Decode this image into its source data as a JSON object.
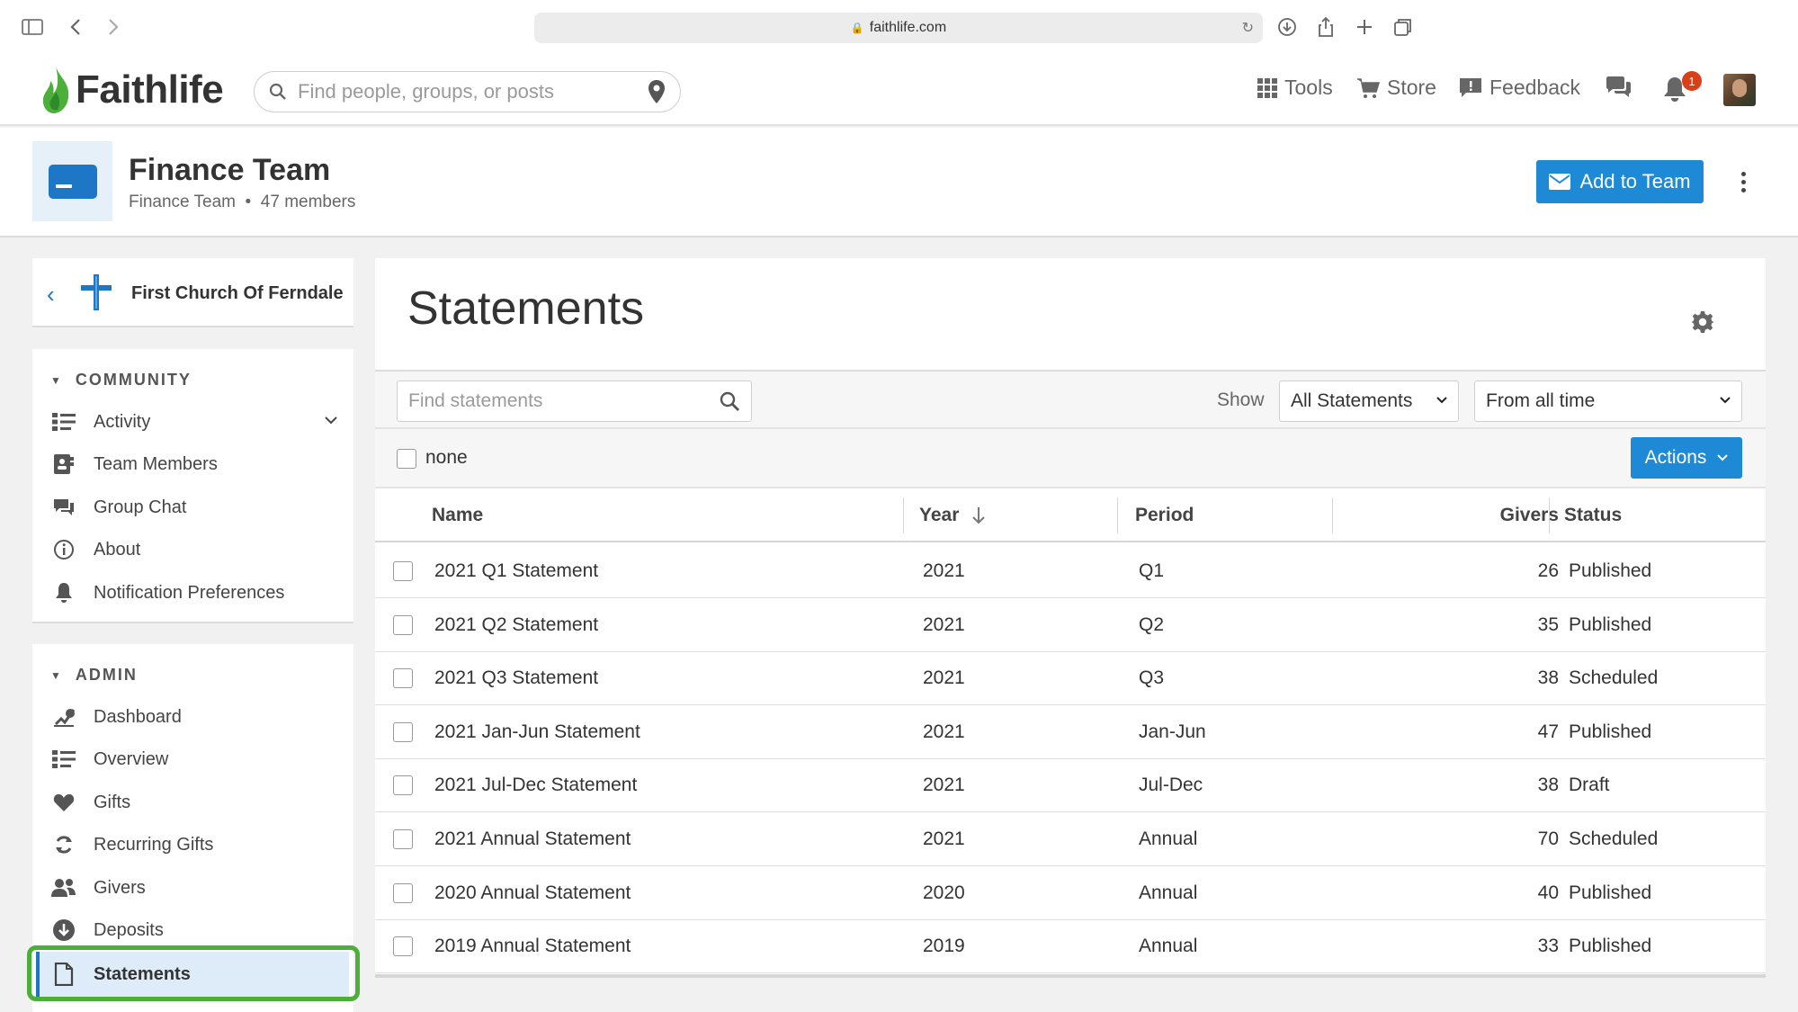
{
  "browser": {
    "url": "faithlife.com"
  },
  "header": {
    "brand": "Faithlife",
    "search_placeholder": "Find people, groups, or posts",
    "nav": {
      "tools": "Tools",
      "store": "Store",
      "feedback": "Feedback"
    },
    "notification_count": "1"
  },
  "group": {
    "title": "Finance Team",
    "subtitle_type": "Finance Team",
    "subtitle_members": "47 members",
    "add_button": "Add to Team"
  },
  "sidebar": {
    "church": "First Church Of Ferndale",
    "community_heading": "COMMUNITY",
    "community_items": [
      {
        "label": "Activity",
        "icon": "activity-list-icon"
      },
      {
        "label": "Team Members",
        "icon": "team-members-icon"
      },
      {
        "label": "Group Chat",
        "icon": "chat-bubble-icon"
      },
      {
        "label": "About",
        "icon": "info-icon"
      },
      {
        "label": "Notification Preferences",
        "icon": "bell-icon"
      }
    ],
    "admin_heading": "ADMIN",
    "admin_items": [
      {
        "label": "Dashboard",
        "icon": "dashboard-icon"
      },
      {
        "label": "Overview",
        "icon": "overview-list-icon"
      },
      {
        "label": "Gifts",
        "icon": "heart-icon"
      },
      {
        "label": "Recurring Gifts",
        "icon": "recurring-icon"
      },
      {
        "label": "Givers",
        "icon": "givers-icon"
      },
      {
        "label": "Deposits",
        "icon": "deposit-icon"
      },
      {
        "label": "Statements",
        "icon": "document-icon",
        "active": true
      }
    ]
  },
  "main": {
    "title": "Statements",
    "find_placeholder": "Find statements",
    "show_label": "Show",
    "show_select": "All Statements",
    "time_select": "From all time",
    "select_none": "none",
    "actions_label": "Actions",
    "columns": {
      "name": "Name",
      "year": "Year",
      "period": "Period",
      "givers": "Givers",
      "status": "Status"
    },
    "rows": [
      {
        "name": "2021 Q1 Statement",
        "year": "2021",
        "period": "Q1",
        "givers": "26",
        "status": "Published"
      },
      {
        "name": "2021 Q2 Statement",
        "year": "2021",
        "period": "Q2",
        "givers": "35",
        "status": "Published"
      },
      {
        "name": "2021 Q3 Statement",
        "year": "2021",
        "period": "Q3",
        "givers": "38",
        "status": "Scheduled"
      },
      {
        "name": "2021 Jan-Jun Statement",
        "year": "2021",
        "period": "Jan-Jun",
        "givers": "47",
        "status": "Published"
      },
      {
        "name": "2021 Jul-Dec Statement",
        "year": "2021",
        "period": "Jul-Dec",
        "givers": "38",
        "status": "Draft"
      },
      {
        "name": "2021 Annual Statement",
        "year": "2021",
        "period": "Annual",
        "givers": "70",
        "status": "Scheduled"
      },
      {
        "name": "2020 Annual Statement",
        "year": "2020",
        "period": "Annual",
        "givers": "40",
        "status": "Published"
      },
      {
        "name": "2019 Annual Statement",
        "year": "2019",
        "period": "Annual",
        "givers": "33",
        "status": "Published"
      }
    ]
  },
  "colors": {
    "accent": "#1e8ad6",
    "brand_green": "#4caf3a",
    "badge": "#d9401a",
    "active_bg": "#deebf8"
  }
}
